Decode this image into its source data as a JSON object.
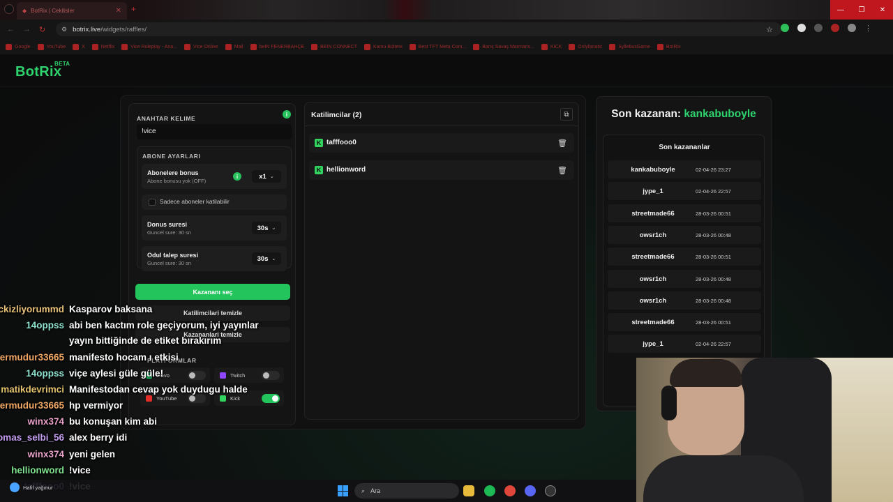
{
  "browser": {
    "tab_title": "BotRix | Cekilisler",
    "url_host": "botrix.live",
    "url_path": "/widgets/raffles/",
    "bookmarks": [
      "Google",
      "YouTube",
      "X",
      "Netflix",
      "Vice Roleplay - Ana...",
      "Vice Online",
      "Mail",
      "beIN FENERBAHÇE",
      "BEIN CONNECT",
      "Kamu Bülteni",
      "Best TFT Meta Com...",
      "Barış Savaş Marmaris...",
      "KICK",
      "Onlyfanatic",
      "SyllebusGame",
      "BotRix"
    ]
  },
  "app": {
    "logo": "BotRix",
    "logo_badge": "BETA"
  },
  "left": {
    "keyword_label": "ANAHTAR KELIME",
    "keyword_value": "!vice",
    "sub_section": "ABONE AYARLARI",
    "sub_bonus": {
      "title": "Abonelere bonus",
      "subtitle": "Abone bonusu yok (OFF)",
      "value": "x1"
    },
    "subs_only": "Sadece aboneler katilabilir",
    "bonus_time": {
      "title": "Donus suresi",
      "subtitle": "Guncel sure: 30 sn",
      "value": "30s"
    },
    "claim_time": {
      "title": "Odul talep suresi",
      "subtitle": "Guncel sure: 30 sn",
      "value": "30s"
    },
    "pick_button": "Kazananı seç",
    "clear_participants": "Katilimcilari temizle",
    "clear_winners": "Kazananlari temizle",
    "platforms_title": "PLATFORMLAR",
    "platforms": [
      {
        "name": "Trovo",
        "on": false
      },
      {
        "name": "Twitch",
        "on": false
      },
      {
        "name": "YouTube",
        "on": false
      },
      {
        "name": "Kick",
        "on": true
      }
    ]
  },
  "middle": {
    "title": "Katilimcilar (2)",
    "participants": [
      "tafffooo0",
      "hellionword"
    ]
  },
  "right": {
    "last_winner_label": "Son kazanan:",
    "last_winner_name": "kankabuboyle",
    "winners_title": "Son kazananlar",
    "winners": [
      {
        "name": "kankabuboyle",
        "date": "02-04-26 23:27"
      },
      {
        "name": "jype_1",
        "date": "02-04-26 22:57"
      },
      {
        "name": "streetmade66",
        "date": "28-03-26 00:51"
      },
      {
        "name": "owsr1ch",
        "date": "28-03-26 00:48"
      },
      {
        "name": "streetmade66",
        "date": "28-03-26 00:51"
      },
      {
        "name": "owsr1ch",
        "date": "28-03-26 00:48"
      },
      {
        "name": "owsr1ch",
        "date": "28-03-26 00:48"
      },
      {
        "name": "streetmade66",
        "date": "28-03-26 00:51"
      },
      {
        "name": "jype_1",
        "date": "02-04-26 22:57"
      }
    ]
  },
  "chat": [
    {
      "user": "ckizliyorummd",
      "msg": "Kasparov baksana",
      "color": "#e7c07a"
    },
    {
      "user": "14oppss",
      "msg": "abi ben kactım role geçiyorum, iyi yayınlar",
      "color": "#8fe3d0"
    },
    {
      "user": "",
      "msg": "yayın bittiğinde de etiket bırakırım",
      "color": "#8fe3d0"
    },
    {
      "user": "ermudur33665",
      "msg": "manifesto hocam ı etkisi",
      "color": "#f0a866"
    },
    {
      "user": "14oppss",
      "msg": "viçe aylesi güle güle!",
      "color": "#8fe3d0"
    },
    {
      "user": "matikdevrimci",
      "msg": "Manifestodan cevap yok duydugu halde",
      "color": "#e4c36f"
    },
    {
      "user": "ermudur33665",
      "msg": "hp vermiyor",
      "color": "#f0a866"
    },
    {
      "user": "winx374",
      "msg": "bu konuşan kim abi",
      "color": "#e7a0c8"
    },
    {
      "user": "omas_selbi_56",
      "msg": "alex berry idi",
      "color": "#c59ff0"
    },
    {
      "user": "winx374",
      "msg": "yeni gelen",
      "color": "#e7a0c8"
    },
    {
      "user": "hellionword",
      "msg": "!vice",
      "color": "#7fe38f"
    },
    {
      "user": "tafffooo0",
      "msg": "!vice",
      "color": "#a9a0ff"
    }
  ],
  "taskbar": {
    "search_placeholder": "Ara",
    "weather_hint": "Hafif yağmur"
  },
  "colors": {
    "accent": "#24c45c",
    "kick": "#33d35f",
    "window_close": "#c0161e"
  }
}
